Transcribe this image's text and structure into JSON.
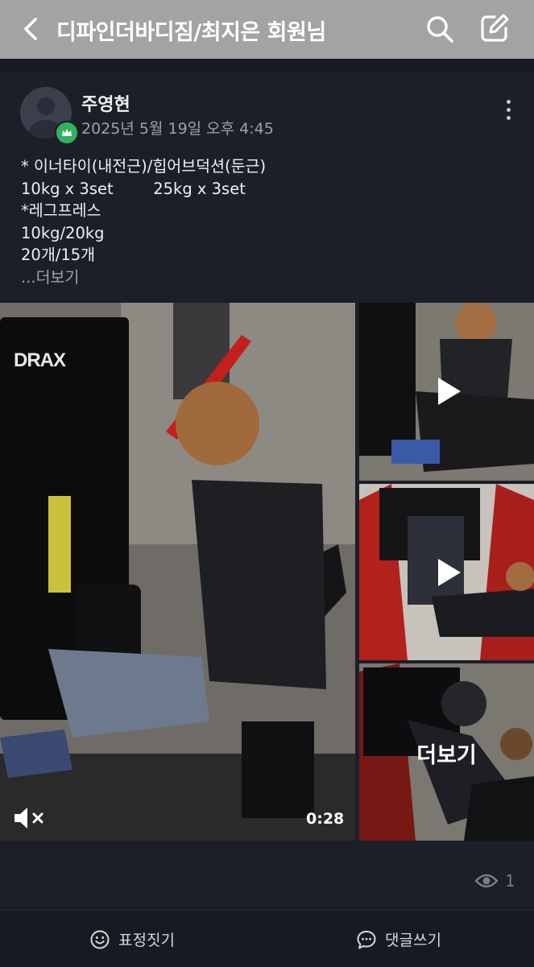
{
  "header": {
    "title": "디파인더바디짐/최지은 회원님",
    "icons": [
      "back-icon",
      "search-icon",
      "write-icon"
    ]
  },
  "post": {
    "author": "주영현",
    "date": "2025년 5월 19일 오후 4:45",
    "badge_icon": "crown-icon",
    "lines": [
      "* 이너타이(내전근)/힙어브덕션(둔근)",
      "10kg x 3set        25kg x 3set",
      "*레그프레스",
      "10kg/20kg",
      "20개/15개"
    ],
    "read_more": "...더보기"
  },
  "media": {
    "main_video_duration": "0:28",
    "main_logo": "DRAX",
    "more_label": "더보기"
  },
  "stats": {
    "views": "1"
  },
  "bottom_bar": {
    "react_label": "표정짓기",
    "comment_label": "댓글쓰기"
  }
}
